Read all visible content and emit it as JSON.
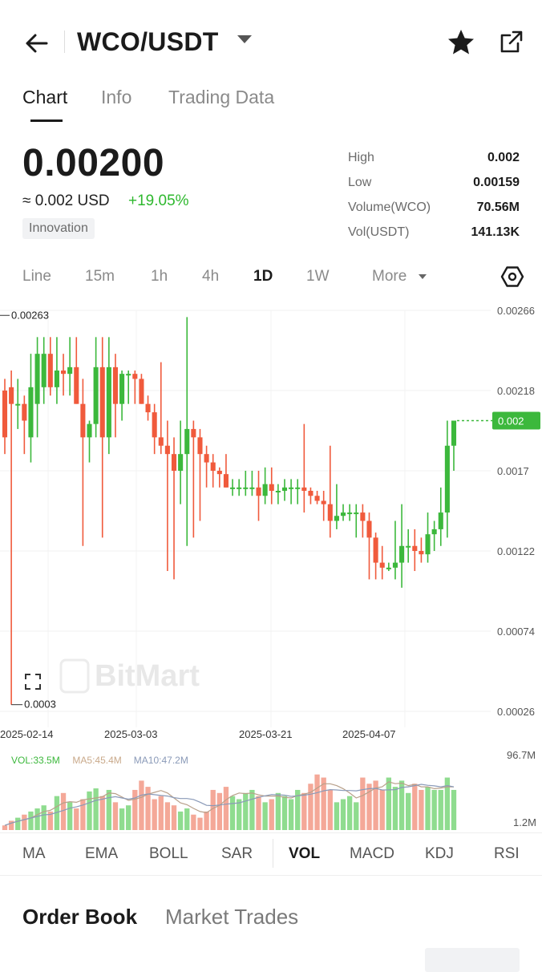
{
  "header": {
    "pair": "WCO/USDT"
  },
  "tabs": [
    {
      "label": "Chart",
      "active": true
    },
    {
      "label": "Info",
      "active": false
    },
    {
      "label": "Trading Data",
      "active": false
    }
  ],
  "ticker": {
    "price": "0.00200",
    "usd": "≈ 0.002 USD",
    "change": "+19.05%",
    "badge": "Innovation",
    "stats": [
      {
        "label": "High",
        "value": "0.002"
      },
      {
        "label": "Low",
        "value": "0.00159"
      },
      {
        "label": "Volume(WCO)",
        "value": "70.56M"
      },
      {
        "label": "Vol(USDT)",
        "value": "141.13K"
      }
    ]
  },
  "timeframes": [
    "Line",
    "15m",
    "1h",
    "4h",
    "1D",
    "1W",
    "More"
  ],
  "active_timeframe": "1D",
  "icons": [
    "back-arrow-icon",
    "caret-down-icon",
    "star-icon",
    "share-icon",
    "settings-hexagon-icon",
    "fullscreen-icon"
  ],
  "colors": {
    "up": "#3cb83c",
    "down": "#f05a3c",
    "up_vol": "#8fdc8f",
    "down_vol": "#f4a898"
  },
  "chart_data": {
    "type": "candlestick",
    "y_axis_labels": [
      "0.00266",
      "0.00218",
      "0.0017",
      "0.00122",
      "0.00074",
      "0.00026"
    ],
    "ylim": [
      0.00026,
      0.00266
    ],
    "x_labels": [
      "2025-02-14",
      "2025-03-03",
      "2025-03-21",
      "2025-04-07"
    ],
    "max_label": "0.00263",
    "min_label": "0.0003",
    "last_price_tag": "0.002",
    "watermark": "BitMart",
    "candles": [
      [
        0.00218,
        0.00225,
        0.0018,
        0.0019
      ],
      [
        0.0022,
        0.0023,
        0.0003,
        0.0021
      ],
      [
        0.0021,
        0.00225,
        0.00195,
        0.0021
      ],
      [
        0.0021,
        0.00215,
        0.0018,
        0.002
      ],
      [
        0.0019,
        0.0024,
        0.00175,
        0.0022
      ],
      [
        0.0021,
        0.0025,
        0.0019,
        0.0024
      ],
      [
        0.0022,
        0.0025,
        0.0021,
        0.0024
      ],
      [
        0.0024,
        0.0025,
        0.00215,
        0.0022
      ],
      [
        0.0022,
        0.0025,
        0.0021,
        0.0023
      ],
      [
        0.0023,
        0.0024,
        0.00215,
        0.00228
      ],
      [
        0.00228,
        0.0025,
        0.00215,
        0.00232
      ],
      [
        0.00232,
        0.0025,
        0.0021,
        0.0021
      ],
      [
        0.0021,
        0.00225,
        0.00125,
        0.0019
      ],
      [
        0.0019,
        0.002,
        0.00175,
        0.00198
      ],
      [
        0.00198,
        0.0025,
        0.0019,
        0.00232
      ],
      [
        0.00232,
        0.0025,
        0.0013,
        0.0019
      ],
      [
        0.0019,
        0.0025,
        0.0018,
        0.00232
      ],
      [
        0.00232,
        0.0024,
        0.0019,
        0.0021
      ],
      [
        0.0021,
        0.0023,
        0.002,
        0.00228
      ],
      [
        0.00228,
        0.0023,
        0.0021,
        0.00228
      ],
      [
        0.00228,
        0.0023,
        0.0021,
        0.00225
      ],
      [
        0.00225,
        0.00228,
        0.0021,
        0.0021
      ],
      [
        0.0021,
        0.00215,
        0.002,
        0.00205
      ],
      [
        0.00205,
        0.0021,
        0.0018,
        0.0019
      ],
      [
        0.0019,
        0.00235,
        0.0018,
        0.00185
      ],
      [
        0.00185,
        0.002,
        0.0011,
        0.0018
      ],
      [
        0.0018,
        0.0019,
        0.00105,
        0.0017
      ],
      [
        0.0017,
        0.002,
        0.0015,
        0.0018
      ],
      [
        0.0018,
        0.00262,
        0.00125,
        0.00195
      ],
      [
        0.00195,
        0.002,
        0.0013,
        0.0019
      ],
      [
        0.0019,
        0.00195,
        0.0014,
        0.0018
      ],
      [
        0.0018,
        0.00185,
        0.0016,
        0.00175
      ],
      [
        0.00175,
        0.0018,
        0.0016,
        0.0017
      ],
      [
        0.0017,
        0.00172,
        0.0016,
        0.00168
      ],
      [
        0.00168,
        0.0018,
        0.0016,
        0.0016
      ],
      [
        0.0016,
        0.00165,
        0.00155,
        0.0016
      ],
      [
        0.0016,
        0.00165,
        0.00155,
        0.0016
      ],
      [
        0.0016,
        0.0017,
        0.00155,
        0.0016
      ],
      [
        0.0016,
        0.0017,
        0.00155,
        0.0016
      ],
      [
        0.0016,
        0.0017,
        0.0014,
        0.00155
      ],
      [
        0.00155,
        0.00172,
        0.0015,
        0.00162
      ],
      [
        0.00162,
        0.00172,
        0.0015,
        0.00158
      ],
      [
        0.00158,
        0.00162,
        0.0015,
        0.00158
      ],
      [
        0.00158,
        0.00165,
        0.00152,
        0.0016
      ],
      [
        0.0016,
        0.00165,
        0.0015,
        0.0016
      ],
      [
        0.0016,
        0.00165,
        0.0015,
        0.0016
      ],
      [
        0.0016,
        0.00198,
        0.00145,
        0.00158
      ],
      [
        0.00158,
        0.0016,
        0.0015,
        0.00155
      ],
      [
        0.00155,
        0.00158,
        0.0015,
        0.00152
      ],
      [
        0.00152,
        0.00158,
        0.0014,
        0.0015
      ],
      [
        0.0015,
        0.00185,
        0.0013,
        0.0014
      ],
      [
        0.0014,
        0.00162,
        0.00135,
        0.00143
      ],
      [
        0.00143,
        0.0015,
        0.0014,
        0.00145
      ],
      [
        0.00145,
        0.0015,
        0.0014,
        0.00145
      ],
      [
        0.00145,
        0.0015,
        0.0013,
        0.00145
      ],
      [
        0.00145,
        0.0015,
        0.0013,
        0.0014
      ],
      [
        0.0014,
        0.00145,
        0.00105,
        0.0013
      ],
      [
        0.0013,
        0.00133,
        0.00105,
        0.00115
      ],
      [
        0.00115,
        0.00125,
        0.00105,
        0.00112
      ],
      [
        0.00112,
        0.00115,
        0.0011,
        0.00112
      ],
      [
        0.00112,
        0.0014,
        0.00105,
        0.00115
      ],
      [
        0.00115,
        0.0015,
        0.001,
        0.00125
      ],
      [
        0.00125,
        0.00135,
        0.00115,
        0.00125
      ],
      [
        0.00125,
        0.00135,
        0.0011,
        0.00122
      ],
      [
        0.00122,
        0.0013,
        0.00115,
        0.0012
      ],
      [
        0.0012,
        0.00145,
        0.00115,
        0.00132
      ],
      [
        0.00132,
        0.0014,
        0.00122,
        0.00135
      ],
      [
        0.00135,
        0.0016,
        0.00125,
        0.00145
      ],
      [
        0.00145,
        0.002,
        0.0013,
        0.00185
      ],
      [
        0.00185,
        0.002,
        0.0017,
        0.002
      ]
    ],
    "volume": {
      "max_label": "96.7M",
      "min_label": "1.2M",
      "legend": [
        "VOL:33.5M",
        "MA5:45.4M",
        "MA10:47.2M"
      ],
      "values": [
        3,
        6,
        8,
        10,
        12,
        14,
        16,
        12,
        22,
        24,
        18,
        14,
        20,
        25,
        27,
        22,
        26,
        18,
        14,
        16,
        26,
        32,
        28,
        20,
        22,
        18,
        16,
        12,
        14,
        10,
        8,
        12,
        26,
        24,
        28,
        22,
        20,
        24,
        26,
        22,
        18,
        20,
        24,
        22,
        20,
        26,
        24,
        30,
        36,
        34,
        26,
        18,
        20,
        22,
        18,
        34,
        30,
        32,
        26,
        34,
        28,
        32,
        24,
        30,
        26,
        28,
        26,
        26,
        34,
        26
      ],
      "ylim": [
        1.2,
        96.7
      ]
    }
  },
  "indicators": [
    "MA",
    "EMA",
    "BOLL",
    "SAR",
    "VOL",
    "MACD",
    "KDJ",
    "RSI"
  ],
  "active_indicator": "VOL",
  "order_tabs": [
    {
      "label": "Order Book",
      "active": true
    },
    {
      "label": "Market Trades",
      "active": false
    }
  ]
}
